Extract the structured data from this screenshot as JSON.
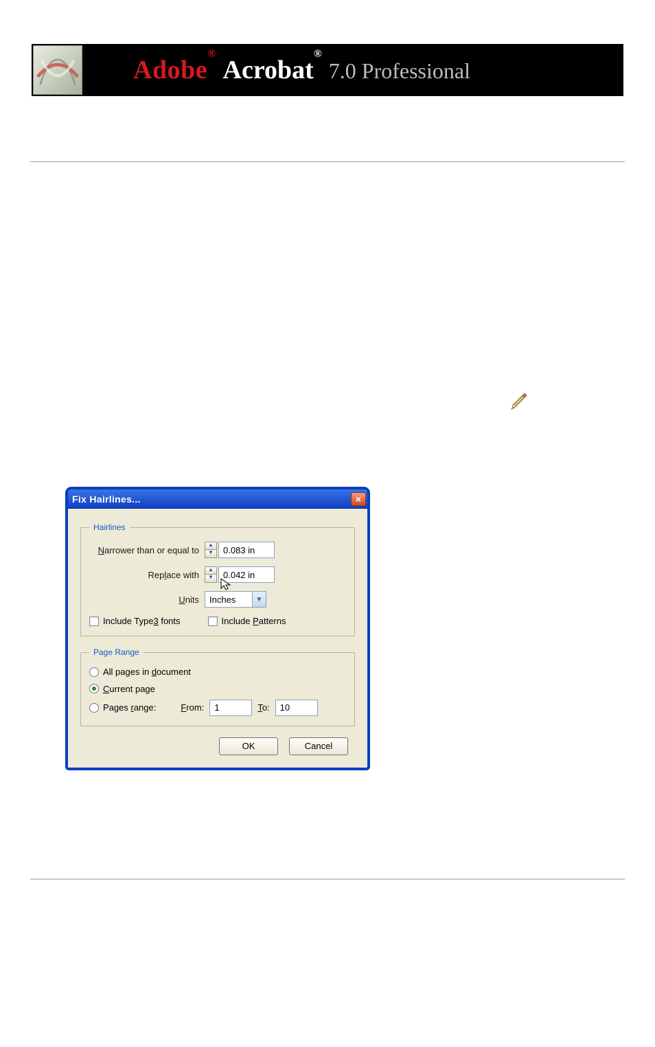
{
  "header": {
    "adobe": "Adobe",
    "acrobat": "Acrobat",
    "version_suffix": "7.0 Professional",
    "reg_mark": "®"
  },
  "pencil_icon_name": "pencil-icon",
  "dialog": {
    "title": "Fix Hairlines...",
    "close_label": "×",
    "hairlines": {
      "legend": "Hairlines",
      "narrower_label_pre": "N",
      "narrower_label": "arrower than or equal to",
      "narrower_value": "0.083 in",
      "replace_label_pre": "Rep",
      "replace_hotkey": "l",
      "replace_label_post": "ace with",
      "replace_value": "0.042 in",
      "units_hotkey": "U",
      "units_label": "nits",
      "units_value": "Inches",
      "include_type3_pre": "Include Type",
      "include_type3_hotkey": "3",
      "include_type3_post": " fonts",
      "include_patterns_pre": "Include ",
      "include_patterns_hotkey": "P",
      "include_patterns_post": "atterns"
    },
    "page_range": {
      "legend": "Page Range",
      "all_pre": "All pages in ",
      "all_hotkey": "d",
      "all_post": "ocument",
      "current_hotkey": "C",
      "current_post": "urrent page",
      "range_pre": "Pages ",
      "range_hotkey": "r",
      "range_post": "ange:",
      "from_hotkey": "F",
      "from_label": "rom:",
      "from_value": "1",
      "to_hotkey": "T",
      "to_label": "o:",
      "to_value": "10"
    },
    "buttons": {
      "ok": "OK",
      "cancel": "Cancel"
    }
  }
}
